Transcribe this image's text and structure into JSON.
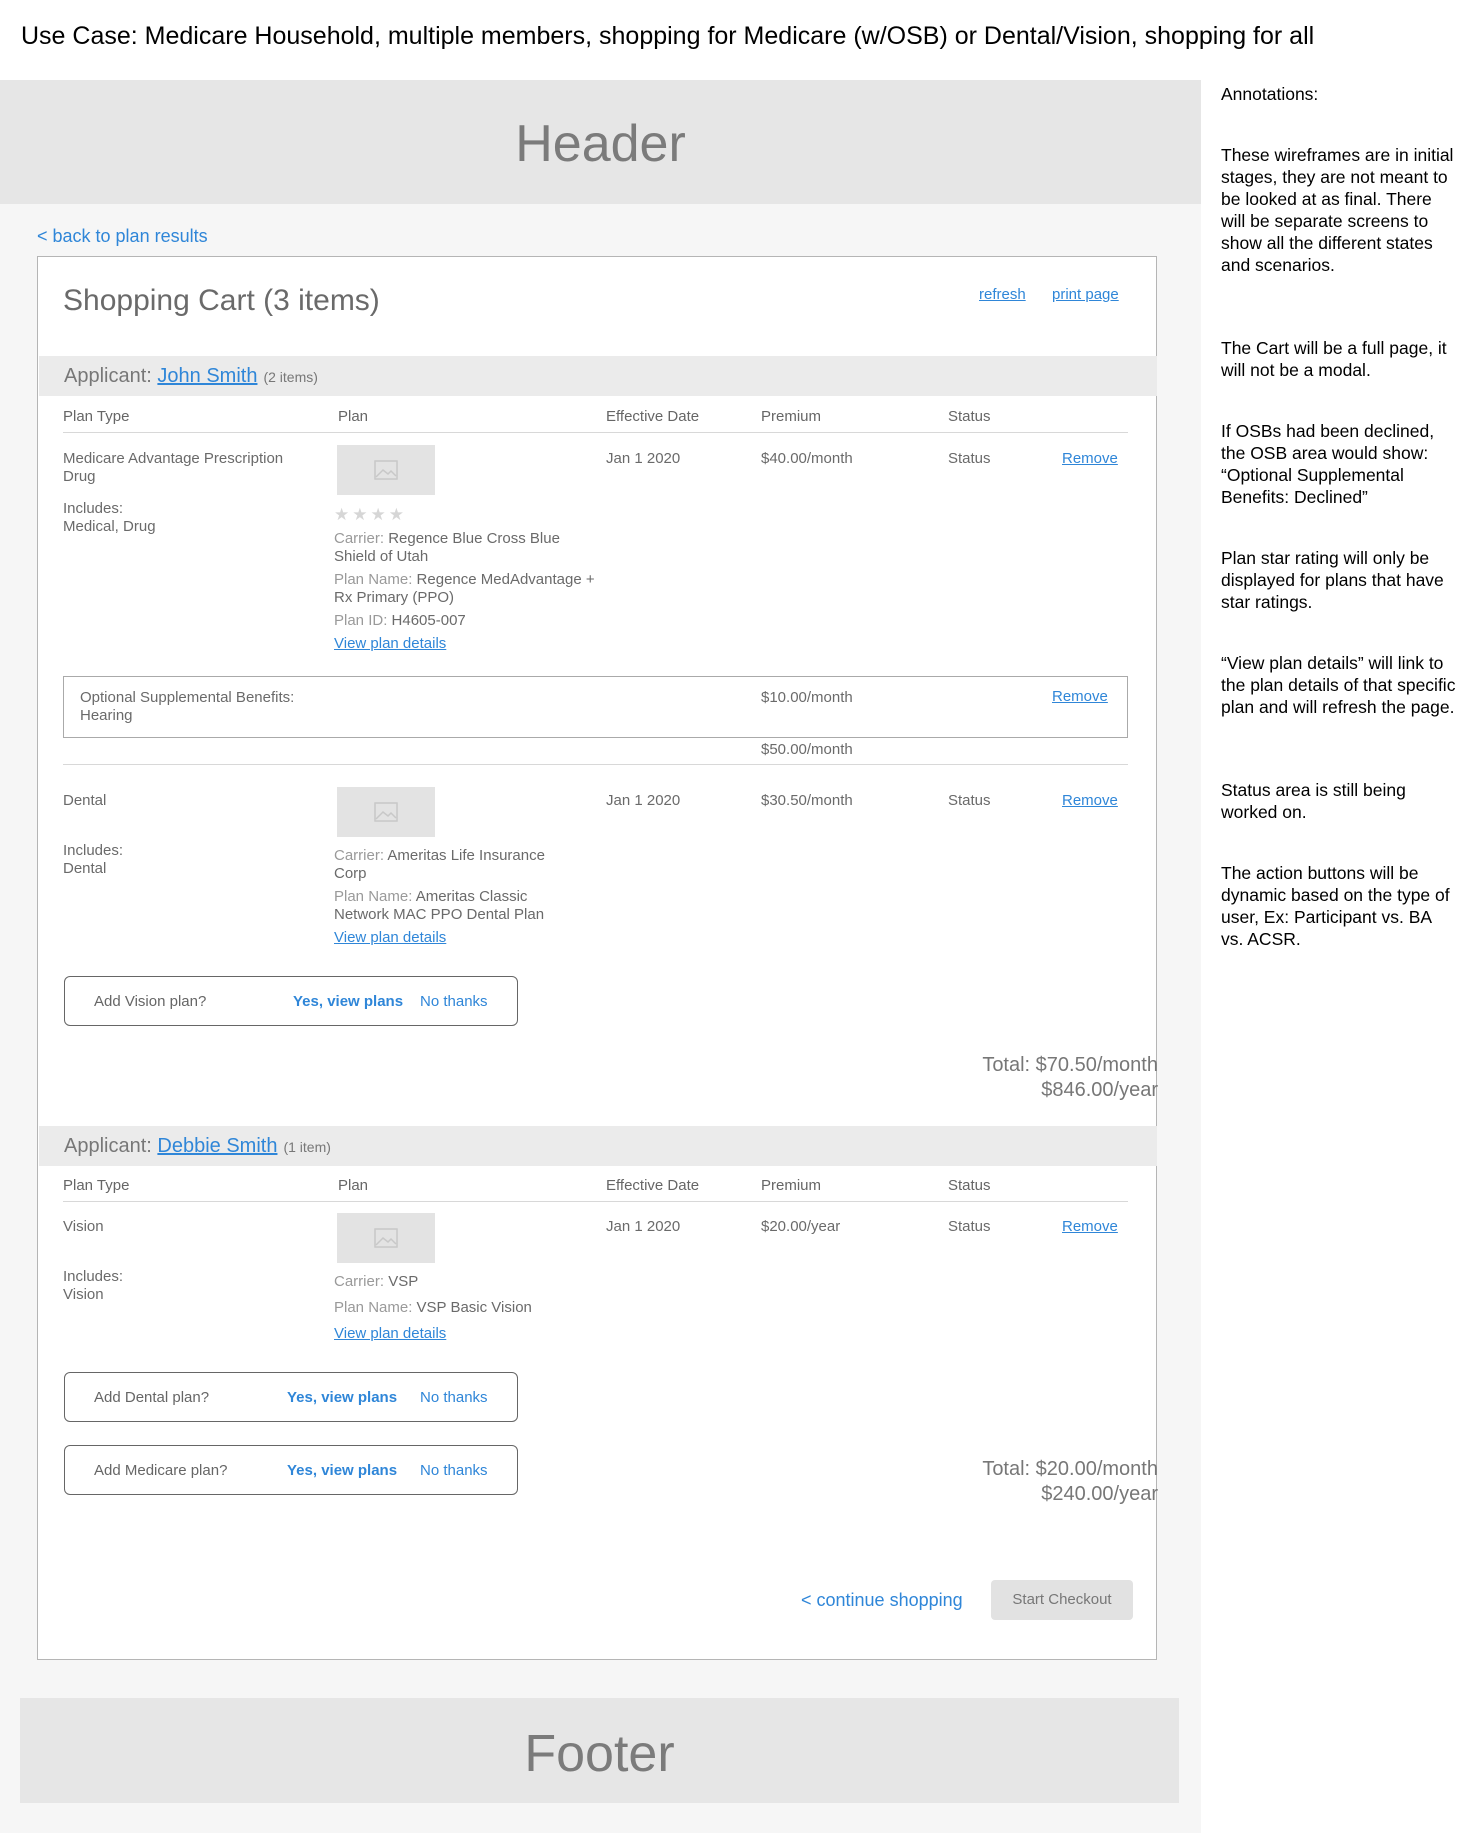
{
  "use_case": "Use Case: Medicare Household, multiple members, shopping for Medicare (w/OSB) or Dental/Vision, shopping for all",
  "header": {
    "label": "Header"
  },
  "footer": {
    "label": "Footer"
  },
  "back_link": "< back to plan results",
  "cart": {
    "title": "Shopping Cart (3 items)",
    "refresh": "refresh",
    "print": "print page",
    "columns": [
      "Plan Type",
      "Plan",
      "Effective Date",
      "Premium",
      "Status"
    ],
    "applicant_label": "Applicant:",
    "applicants": [
      {
        "name": "John Smith",
        "count": "(2 items)",
        "plans": [
          {
            "type": "Medicare Advantage Prescription Drug",
            "includes_label": "Includes:",
            "includes": "Medical, Drug",
            "carrier_label": "Carrier:",
            "carrier": "Regence Blue Cross Blue Shield of Utah",
            "plan_name_label": "Plan Name:",
            "plan_name": "Regence MedAdvantage + Rx Primary (PPO)",
            "plan_id_label": "Plan ID:",
            "plan_id": "H4605-007",
            "details": "View plan details",
            "effective": "Jan 1 2020",
            "premium": "$40.00/month",
            "status": "Status",
            "remove": "Remove",
            "stars": 4
          },
          {
            "type": "Dental",
            "includes_label": "Includes:",
            "includes": "Dental",
            "carrier_label": "Carrier:",
            "carrier": "Ameritas Life Insurance Corp",
            "plan_name_label": "Plan Name:",
            "plan_name": "Ameritas Classic Network MAC PPO Dental Plan",
            "details": "View plan details",
            "effective": "Jan 1 2020",
            "premium": "$30.50/month",
            "status": "Status",
            "remove": "Remove"
          }
        ],
        "osb": {
          "label": "Optional Supplemental Benefits:",
          "value": "Hearing",
          "premium": "$10.00/month",
          "remove": "Remove",
          "subtotal": "$50.00/month"
        },
        "add_prompts": [
          {
            "question": "Add Vision plan?",
            "yes": "Yes, view plans",
            "no": "No thanks"
          }
        ],
        "total_month": "Total: $70.50/month",
        "total_year": "$846.00/year"
      },
      {
        "name": "Debbie Smith",
        "count": "(1 item)",
        "plans": [
          {
            "type": "Vision",
            "includes_label": "Includes:",
            "includes": "Vision",
            "carrier_label": "Carrier:",
            "carrier": "VSP",
            "plan_name_label": "Plan Name:",
            "plan_name": "VSP Basic Vision",
            "details": "View plan details",
            "effective": "Jan 1 2020",
            "premium": "$20.00/year",
            "status": "Status",
            "remove": "Remove"
          }
        ],
        "add_prompts": [
          {
            "question": "Add Dental plan?",
            "yes": "Yes, view plans",
            "no": "No thanks"
          },
          {
            "question": "Add Medicare plan?",
            "yes": "Yes, view plans",
            "no": "No thanks"
          }
        ],
        "total_month": "Total: $20.00/month",
        "total_year": "$240.00/year"
      }
    ],
    "continue_shopping": "< continue shopping",
    "start_checkout": "Start Checkout"
  },
  "annotations": {
    "title": "Annotations:",
    "notes": [
      "These wireframes are in initial stages, they are not meant to be looked at as final. There will be separate screens to show all the different states and scenarios.",
      "The Cart will be a full page, it will not be a modal.",
      "If OSBs had been declined, the OSB area would show: “Optional Supplemental Benefits: Declined”",
      "Plan star rating will only be displayed for plans that have star ratings.",
      "“View plan details” will link to the plan details of that specific plan and will refresh the page.",
      "Status area is still being worked on.",
      "The action buttons will be dynamic based on the type of user, Ex: Participant vs. BA vs. ACSR."
    ]
  },
  "icons": {
    "thumbnail": "image-placeholder-icon",
    "star": "star-icon"
  }
}
